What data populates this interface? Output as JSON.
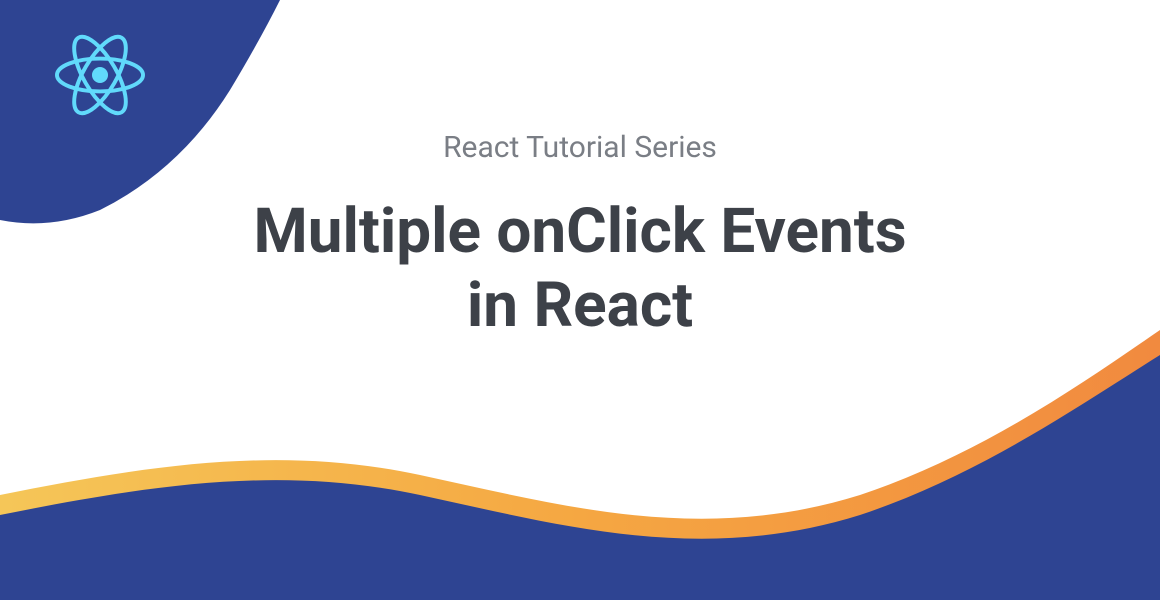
{
  "subtitle": "React Tutorial Series",
  "title": "Multiple onClick Events\nin React",
  "colors": {
    "darkBlue": "#2e4492",
    "lightBlue": "#61dafb",
    "orange": "#f5a742",
    "orangeDark": "#f18a3f",
    "textGray": "#3d4148",
    "subtitleGray": "#7a7e85"
  }
}
